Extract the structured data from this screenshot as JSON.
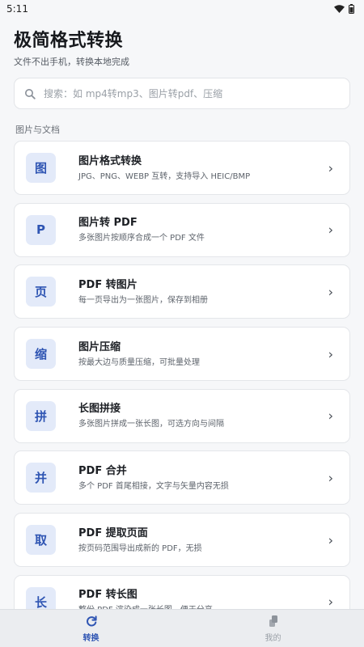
{
  "status_bar": {
    "time": "5:11"
  },
  "header": {
    "title": "极简格式转换",
    "subtitle": "文件不出手机，转换本地完成"
  },
  "search": {
    "placeholder": "搜索：如 mp4转mp3、图片转pdf、压缩",
    "value": ""
  },
  "section": {
    "label": "图片与文档"
  },
  "tools": [
    {
      "badge": "图",
      "title": "图片格式转换",
      "desc": "JPG、PNG、WEBP 互转，支持导入 HEIC/BMP"
    },
    {
      "badge": "P",
      "title": "图片转 PDF",
      "desc": "多张图片按顺序合成一个 PDF 文件"
    },
    {
      "badge": "页",
      "title": "PDF 转图片",
      "desc": "每一页导出为一张图片，保存到相册"
    },
    {
      "badge": "缩",
      "title": "图片压缩",
      "desc": "按最大边与质量压缩，可批量处理"
    },
    {
      "badge": "拼",
      "title": "长图拼接",
      "desc": "多张图片拼成一张长图，可选方向与间隔"
    },
    {
      "badge": "并",
      "title": "PDF 合并",
      "desc": "多个 PDF 首尾相接，文字与矢量内容无损"
    },
    {
      "badge": "取",
      "title": "PDF 提取页面",
      "desc": "按页码范围导出成新的 PDF，无损"
    },
    {
      "badge": "长",
      "title": "PDF 转长图",
      "desc": "整份 PDF 渲染成一张长图，便于分享"
    }
  ],
  "chevron": "›",
  "tabs": [
    {
      "label": "转换",
      "icon": "convert-icon",
      "active": true
    },
    {
      "label": "我的",
      "icon": "profile-icon",
      "active": false
    }
  ],
  "colors": {
    "accent": "#2f55b3",
    "badge_bg": "#e3eaf9",
    "background": "#f6f7f9"
  }
}
